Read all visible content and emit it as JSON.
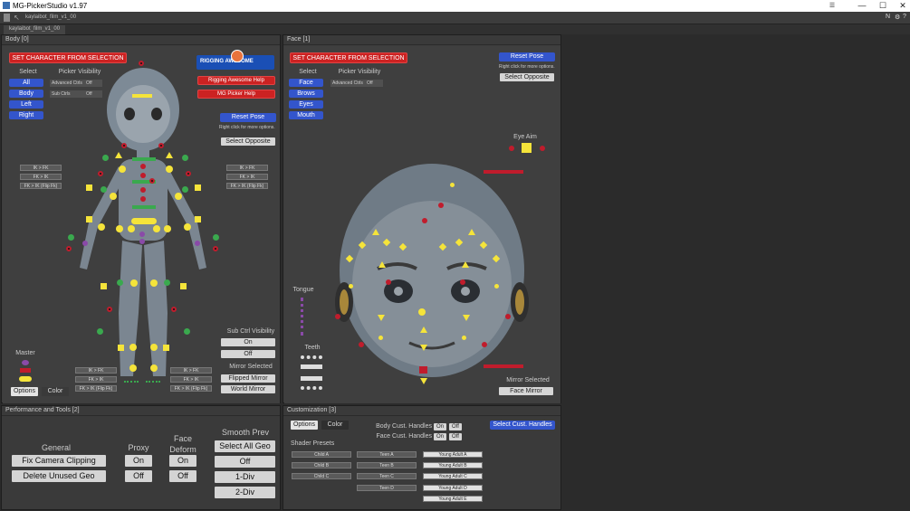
{
  "window": {
    "title": "MG-PickerStudio v1.97",
    "minimize": "—",
    "maximize": "☐",
    "close": "✕"
  },
  "toolbar": {
    "file_title": "kaylaibot_film_v1_00"
  },
  "tabs": [
    {
      "label": "kaylaibot_film_v1_00"
    }
  ],
  "body_panel": {
    "title": "Body [0]",
    "set_char_button": "SET CHARACTER FROM SELECTION",
    "select_label": "Select",
    "picker_visibility_label": "Picker Visibility",
    "select_buttons": [
      "All",
      "Body",
      "Left",
      "Right"
    ],
    "advanced_ctrls": {
      "label": "Advanced Ctrls",
      "value": "Off"
    },
    "sub_ctrls": {
      "label": "Sub Ctrls",
      "value": "Off"
    },
    "logo_text": "RIGGING AWESOME",
    "help_buttons": [
      "Rigging Awesome Help",
      "MG Picker Help"
    ],
    "reset_pose": "Reset Pose",
    "reset_hint": "Right click for more options.",
    "select_opposite": "Select Opposite",
    "ikfk_left": [
      "IK > FK",
      "FK > IK",
      "FK > IK (Flip Fk)"
    ],
    "ikfk_right": [
      "IK > FK",
      "FK > IK",
      "FK > IK (Flip Fk)"
    ],
    "ikfk_leg_left": [
      "IK > FK",
      "FK > IK",
      "FK > IK (Flip Fk)"
    ],
    "ikfk_leg_right": [
      "IK > FK",
      "FK > IK",
      "FK > IK (Flip Fk)"
    ],
    "sub_ctrl_visibility": {
      "label": "Sub Ctrl Visibility",
      "on": "On",
      "off": "Off"
    },
    "mirror_selected": {
      "label": "Mirror Selected",
      "flipped": "Flipped Mirror",
      "world": "World Mirror"
    },
    "master_label": "Master",
    "options": "Options",
    "color": "Color"
  },
  "face_panel": {
    "title": "Face [1]",
    "set_char_button": "SET CHARACTER FROM SELECTION",
    "select_label": "Select",
    "picker_visibility_label": "Picker Visibility",
    "select_buttons": [
      "Face",
      "Brows",
      "Eyes",
      "Mouth"
    ],
    "advanced_ctrls": {
      "label": "Advanced Ctrls",
      "value": "Off"
    },
    "reset_pose": "Reset Pose",
    "reset_hint": "Right click for more options.",
    "select_opposite": "Select Opposite",
    "eye_aim": "Eye Aim",
    "tongue": "Tongue",
    "teeth": "Teeth",
    "mirror_selected": {
      "label": "Mirror Selected",
      "face_mirror": "Face Mirror"
    }
  },
  "perf_panel": {
    "title": "Performance and Tools [2]",
    "general": {
      "label": "General",
      "buttons": [
        "Fix Camera Clipping",
        "Delete Unused Geo"
      ]
    },
    "proxy": {
      "label": "Proxy",
      "on": "On",
      "off": "Off"
    },
    "face_deform": {
      "label": "Face\nDeform",
      "on": "On",
      "off": "Off"
    },
    "smooth_prev": {
      "label": "Smooth Prev",
      "buttons": [
        "Select All Geo",
        "Off",
        "1-Div",
        "2-Div"
      ]
    }
  },
  "custom_panel": {
    "title": "Customization [3]",
    "options": "Options",
    "color": "Color",
    "body_cust": {
      "label": "Body Cust. Handles",
      "on": "On",
      "off": "Off"
    },
    "face_cust": {
      "label": "Face Cust. Handles",
      "on": "On",
      "off": "Off"
    },
    "select_cust": "Select Cust. Handles",
    "shader_presets": "Shader Presets",
    "child": [
      "Child A",
      "Child B",
      "Child C"
    ],
    "teen": [
      "Teen A",
      "Teen B",
      "Teen C",
      "Teen D"
    ],
    "adult": [
      "Young Adult A",
      "Young Adult B",
      "Young Adult C",
      "Young Adult D",
      "Young Adult E"
    ]
  },
  "colors": {
    "accent_red": "#cc2222",
    "accent_blue": "#3355cc",
    "ctrl_yellow": "#f5e43a",
    "ctrl_red": "#c01c2c",
    "ctrl_green": "#3aa94e"
  }
}
